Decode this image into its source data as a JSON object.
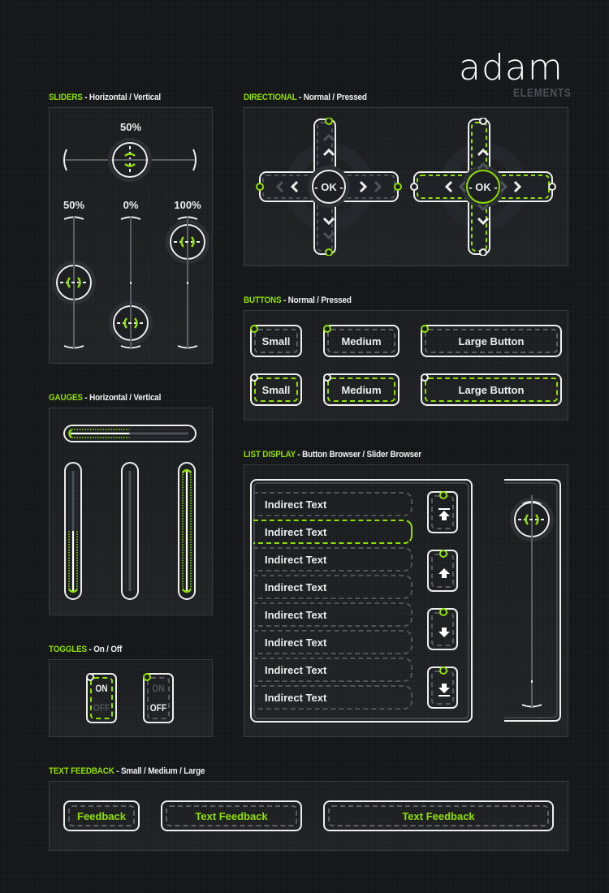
{
  "logo": {
    "word": "adam",
    "sub": "ELEMENTS"
  },
  "colors": {
    "accent": "#8fe000",
    "background": "#1b1d20",
    "outline": "#f2f2f2",
    "dashed": "#5a5f66"
  },
  "sections": {
    "sliders": {
      "title": "SLIDERS",
      "subtitle": " - Horizontal / Vertical"
    },
    "directional": {
      "title": "DIRECTIONAL",
      "subtitle": " - Normal / Pressed"
    },
    "buttons": {
      "title": "BUTTONS",
      "subtitle": " - Normal / Pressed"
    },
    "gauges": {
      "title": "GAUGES",
      "subtitle": " - Horizontal / Vertical"
    },
    "toggles": {
      "title": "TOGGLES",
      "subtitle": " - On / Off"
    },
    "list_display": {
      "title": "LIST DISPLAY",
      "subtitle": " - Button Browser / Slider Browser"
    },
    "text_feedback": {
      "title": "TEXT FEEDBACK",
      "subtitle": " - Small / Medium / Large"
    }
  },
  "sliders": {
    "horizontal": {
      "label": "50%",
      "value": 0.5
    },
    "vertical": [
      {
        "label": "50%",
        "value": 0.5
      },
      {
        "label": "0%",
        "value": 0.0
      },
      {
        "label": "100%",
        "value": 1.0
      }
    ]
  },
  "directional": {
    "ok_label": "OK",
    "normal": {
      "state": "normal"
    },
    "pressed": {
      "state": "pressed"
    }
  },
  "buttons": {
    "normal": [
      "Small",
      "Medium",
      "Large Button"
    ],
    "pressed": [
      "Small",
      "Medium",
      "Large Button"
    ]
  },
  "gauges": {
    "horizontal": {
      "value": 0.5
    },
    "vertical": [
      {
        "value": 0.5
      },
      {
        "value": 0.0
      },
      {
        "value": 1.0
      }
    ]
  },
  "toggles": [
    {
      "on_label": "ON",
      "off_label": "OFF",
      "state": "on"
    },
    {
      "on_label": "ON",
      "off_label": "OFF",
      "state": "off"
    }
  ],
  "list_display": {
    "items": [
      "Indirect Text",
      "Indirect Text",
      "Indirect Text",
      "Indirect Text",
      "Indirect Text",
      "Indirect Text",
      "Indirect Text",
      "Indirect Text"
    ],
    "selected_index": 1,
    "nav_buttons": [
      "scroll-to-top",
      "scroll-up",
      "scroll-down",
      "scroll-to-bottom"
    ],
    "slider_browser": {
      "value": 1.0
    }
  },
  "text_feedback": [
    "Feedback",
    "Text Feedback",
    "Text Feedback"
  ]
}
